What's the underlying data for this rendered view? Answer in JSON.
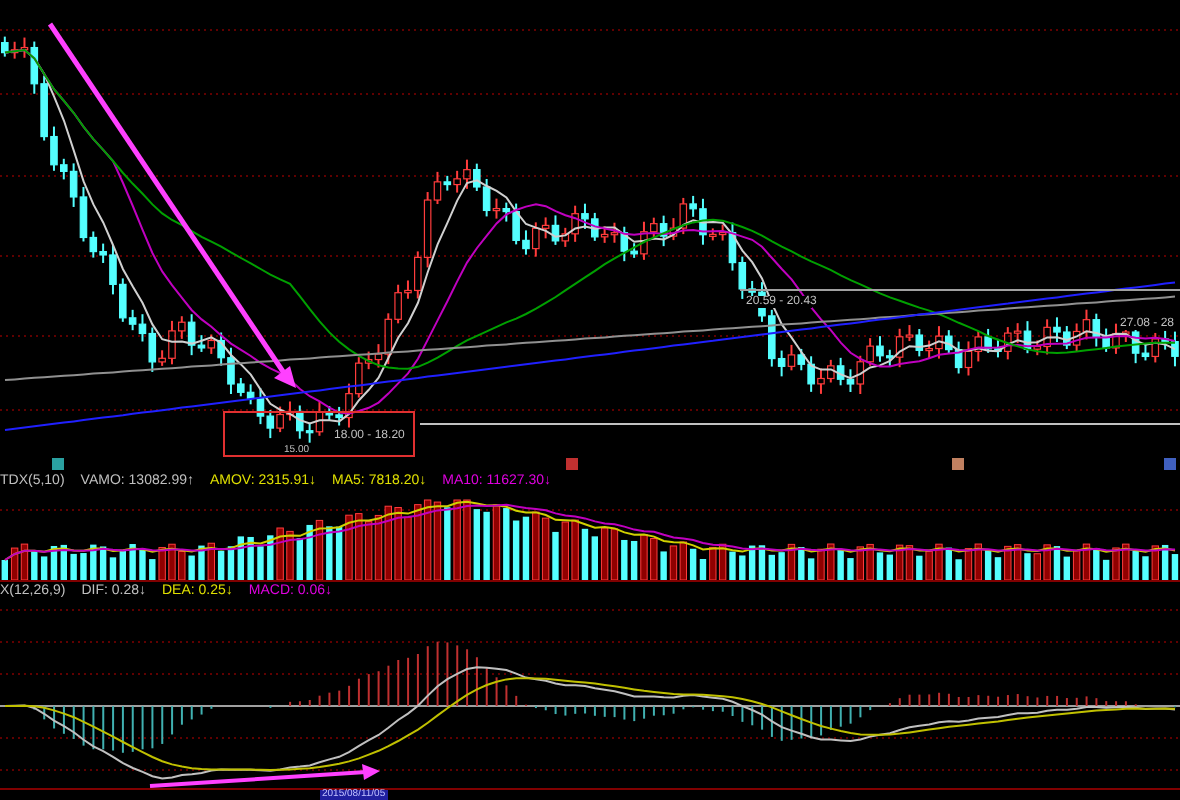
{
  "price_chart": {
    "range_labels": [
      "18.00 - 18.20",
      "20.59 - 20.43",
      "27.08 - 28"
    ],
    "low_label": "15.00"
  },
  "volume_panel": {
    "indicator": "TDX(5,10)",
    "values": [
      {
        "label": "VAMO: 13082.99↑",
        "color": "#c0c0c0"
      },
      {
        "label": "AMOV: 2315.91↓",
        "color": "#e0e000"
      },
      {
        "label": "MA5: 7818.20↓",
        "color": "#e0e000"
      },
      {
        "label": "MA10: 11627.30↓",
        "color": "#e000e0"
      }
    ]
  },
  "macd_panel": {
    "indicator": "X(12,26,9)",
    "values": [
      {
        "label": "DIF: 0.28↓",
        "color": "#c0c0c0"
      },
      {
        "label": "DEA: 0.25↓",
        "color": "#e0e000"
      },
      {
        "label": "MACD: 0.06↓",
        "color": "#e000e0"
      }
    ]
  },
  "date_axis": {
    "highlight": "2015/08/11/05"
  }
}
